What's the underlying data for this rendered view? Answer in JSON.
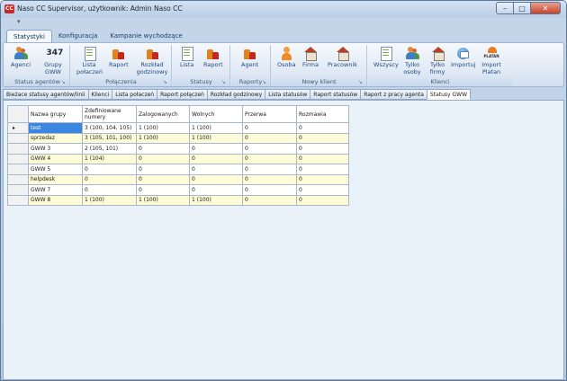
{
  "window": {
    "title": "Naso CC Supervisor, użytkownik: Admin Naso CC",
    "app_icon_text": "CC",
    "minimize": "–",
    "maximize": "□",
    "close": "✕"
  },
  "ribbon_tabs": [
    "Statystyki",
    "Konfiguracja",
    "Kampanie wychodzące"
  ],
  "ribbon_groups": [
    {
      "label": "Status agentów",
      "buttons": [
        {
          "label": "Agenci",
          "icon": "people-icon"
        },
        {
          "label": "Grupy GWW",
          "icon": "347-icon",
          "icon_text": "347"
        }
      ]
    },
    {
      "label": "Połączenia",
      "buttons": [
        {
          "label": "Lista połaczeń",
          "icon": "document-icon"
        },
        {
          "label": "Raport",
          "icon": "chart-icon"
        },
        {
          "label": "Rozkład godzinowy",
          "icon": "chart-icon"
        }
      ]
    },
    {
      "label": "Statusy",
      "buttons": [
        {
          "label": "Lista",
          "icon": "document-icon"
        },
        {
          "label": "Raport",
          "icon": "chart-icon"
        }
      ]
    },
    {
      "label": "Raporty",
      "buttons": [
        {
          "label": "Agent",
          "icon": "chart-icon"
        }
      ]
    },
    {
      "label": "Nowy klient",
      "buttons": [
        {
          "label": "Osoba",
          "icon": "person-icon"
        },
        {
          "label": "Firma",
          "icon": "house-icon"
        },
        {
          "label": "Pracownik",
          "icon": "house-icon"
        }
      ]
    },
    {
      "label": "Klienci",
      "buttons": [
        {
          "label": "Wszyscy",
          "icon": "document-icon"
        },
        {
          "label": "Tylko osoby",
          "icon": "people-icon"
        },
        {
          "label": "Tylko firmy",
          "icon": "house-icon"
        },
        {
          "label": "Importuj",
          "icon": "globe-icon"
        },
        {
          "label": "Import Platan",
          "icon": "platan-icon"
        }
      ]
    }
  ],
  "doc_tabs": [
    "Bieżace statusy agentów/linii",
    "Klienci",
    "Lista połaczeń",
    "Raport połączeń",
    "Rozkład godzinowy",
    "Lista statusów",
    "Raport statusów",
    "Raport z pracy agenta",
    "Statusy GWW"
  ],
  "active_doc_tab": 8,
  "grid": {
    "columns": [
      "Nazwa grupy",
      "Zdefiniowane numery",
      "Zalogowanych",
      "Wolnych",
      "Przerwa",
      "Rozmawia"
    ],
    "rows": [
      [
        "test",
        "3 (100, 104, 105)",
        "1 (100)",
        "1 (100)",
        "0",
        "0"
      ],
      [
        "sprzedaz",
        "3 (105, 101, 100)",
        "1 (100)",
        "1 (100)",
        "0",
        "0"
      ],
      [
        "GWW 3",
        "2 (105, 101)",
        "0",
        "0",
        "0",
        "0"
      ],
      [
        "GWW 4",
        "1 (104)",
        "0",
        "0",
        "0",
        "0"
      ],
      [
        "GWW 5",
        "0",
        "0",
        "0",
        "0",
        "0"
      ],
      [
        "helpdesk",
        "0",
        "0",
        "0",
        "0",
        "0"
      ],
      [
        "GWW 7",
        "0",
        "0",
        "0",
        "0",
        "0"
      ],
      [
        "GWW 8",
        "1 (100)",
        "1 (100)",
        "1 (100)",
        "0",
        "0"
      ]
    ],
    "selected_row": 0,
    "row_indicator": "▸"
  },
  "colors": {
    "alt_row": "#fefbd7",
    "selection": "#3b86e0"
  }
}
